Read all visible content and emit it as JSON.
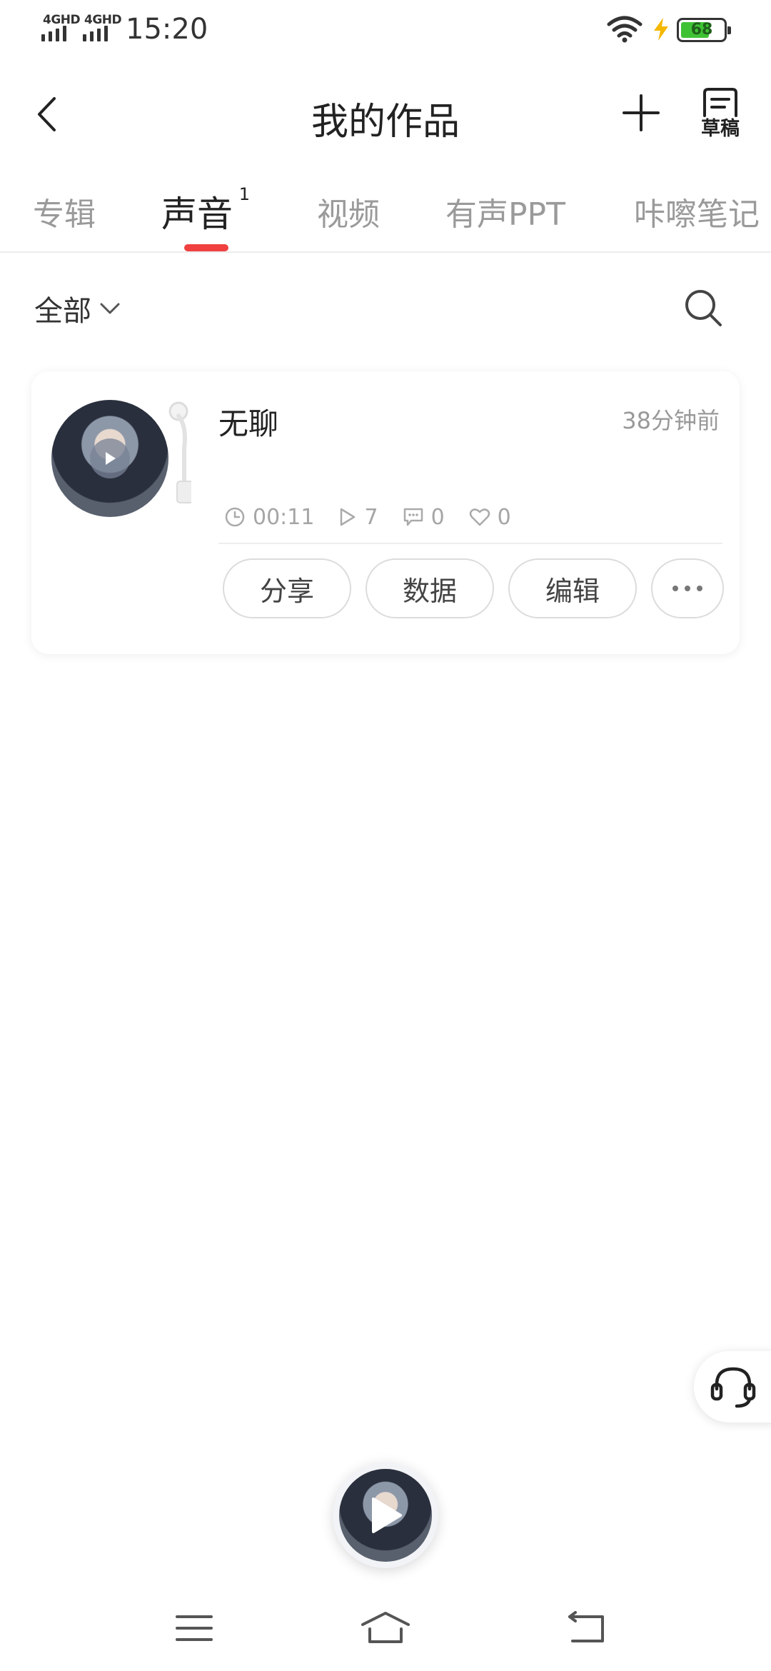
{
  "status_bar": {
    "network_1": "4GHD",
    "network_2": "4GHD",
    "time": "15:20",
    "battery": "68",
    "battery_level": 0.68
  },
  "header": {
    "title": "我的作品",
    "draft_label": "草稿"
  },
  "tabs": [
    {
      "label": "专辑"
    },
    {
      "label": "声音",
      "badge": "1",
      "active": true
    },
    {
      "label": "视频"
    },
    {
      "label": "有声PPT"
    },
    {
      "label": "咔嚓笔记"
    }
  ],
  "filter": {
    "label": "全部"
  },
  "tracks": [
    {
      "title": "无聊",
      "time_ago": "38分钟前",
      "duration": "00:11",
      "plays": "7",
      "comments": "0",
      "likes": "0",
      "actions": {
        "share": "分享",
        "data": "数据",
        "edit": "编辑"
      }
    }
  ],
  "colors": {
    "accent": "#f04040",
    "battery": "#3ec234",
    "muted_text": "#999999"
  }
}
